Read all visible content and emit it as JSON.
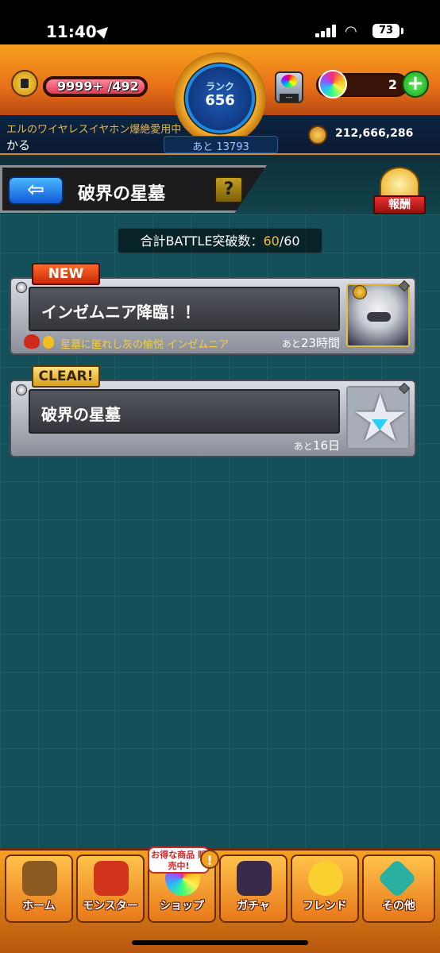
{
  "status_bar": {
    "time": "11:40",
    "battery": "73"
  },
  "header": {
    "stamina": "9999+ /492",
    "stamina_level": 1.0,
    "rank_label": "ランク",
    "rank_value": "656",
    "rank_next": "あと 13793",
    "machine_label": "---",
    "orb_count": "2",
    "plus_label": "+",
    "title_line": "エルのワイヤレスイヤホン爆絶愛用中",
    "username": "かる",
    "coins": "212,666,286"
  },
  "banner": {
    "back_label": "⇦",
    "title": "破界の星墓",
    "help_label": "?",
    "reward_label": "報酬"
  },
  "battle_count": {
    "label": "合計BATTLE突破数：",
    "current": "60",
    "total": "/60"
  },
  "quests": [
    {
      "tag": "NEW",
      "title": "インゼムニア降臨！！",
      "meta": "星墓に匿れし灰の愉悦 インゼムニア",
      "time_prefix": "あと",
      "time": "23時間"
    },
    {
      "tag": "CLEAR!",
      "title": "破界の星墓",
      "meta": "",
      "time_prefix": "あと",
      "time": "16日"
    }
  ],
  "nav": {
    "items": [
      {
        "label": "ホーム",
        "color": "#8a5a20"
      },
      {
        "label": "モンスター",
        "color": "#d0341a"
      },
      {
        "label": "ショップ",
        "color": "#ffffff"
      },
      {
        "label": "ガチャ",
        "color": "#3a2a4a"
      },
      {
        "label": "フレンド",
        "color": "#f8d030"
      },
      {
        "label": "その他",
        "color": "#2ab0a0"
      }
    ],
    "shop_badge": "お得な商品 販売中!",
    "shop_alert": "!"
  }
}
